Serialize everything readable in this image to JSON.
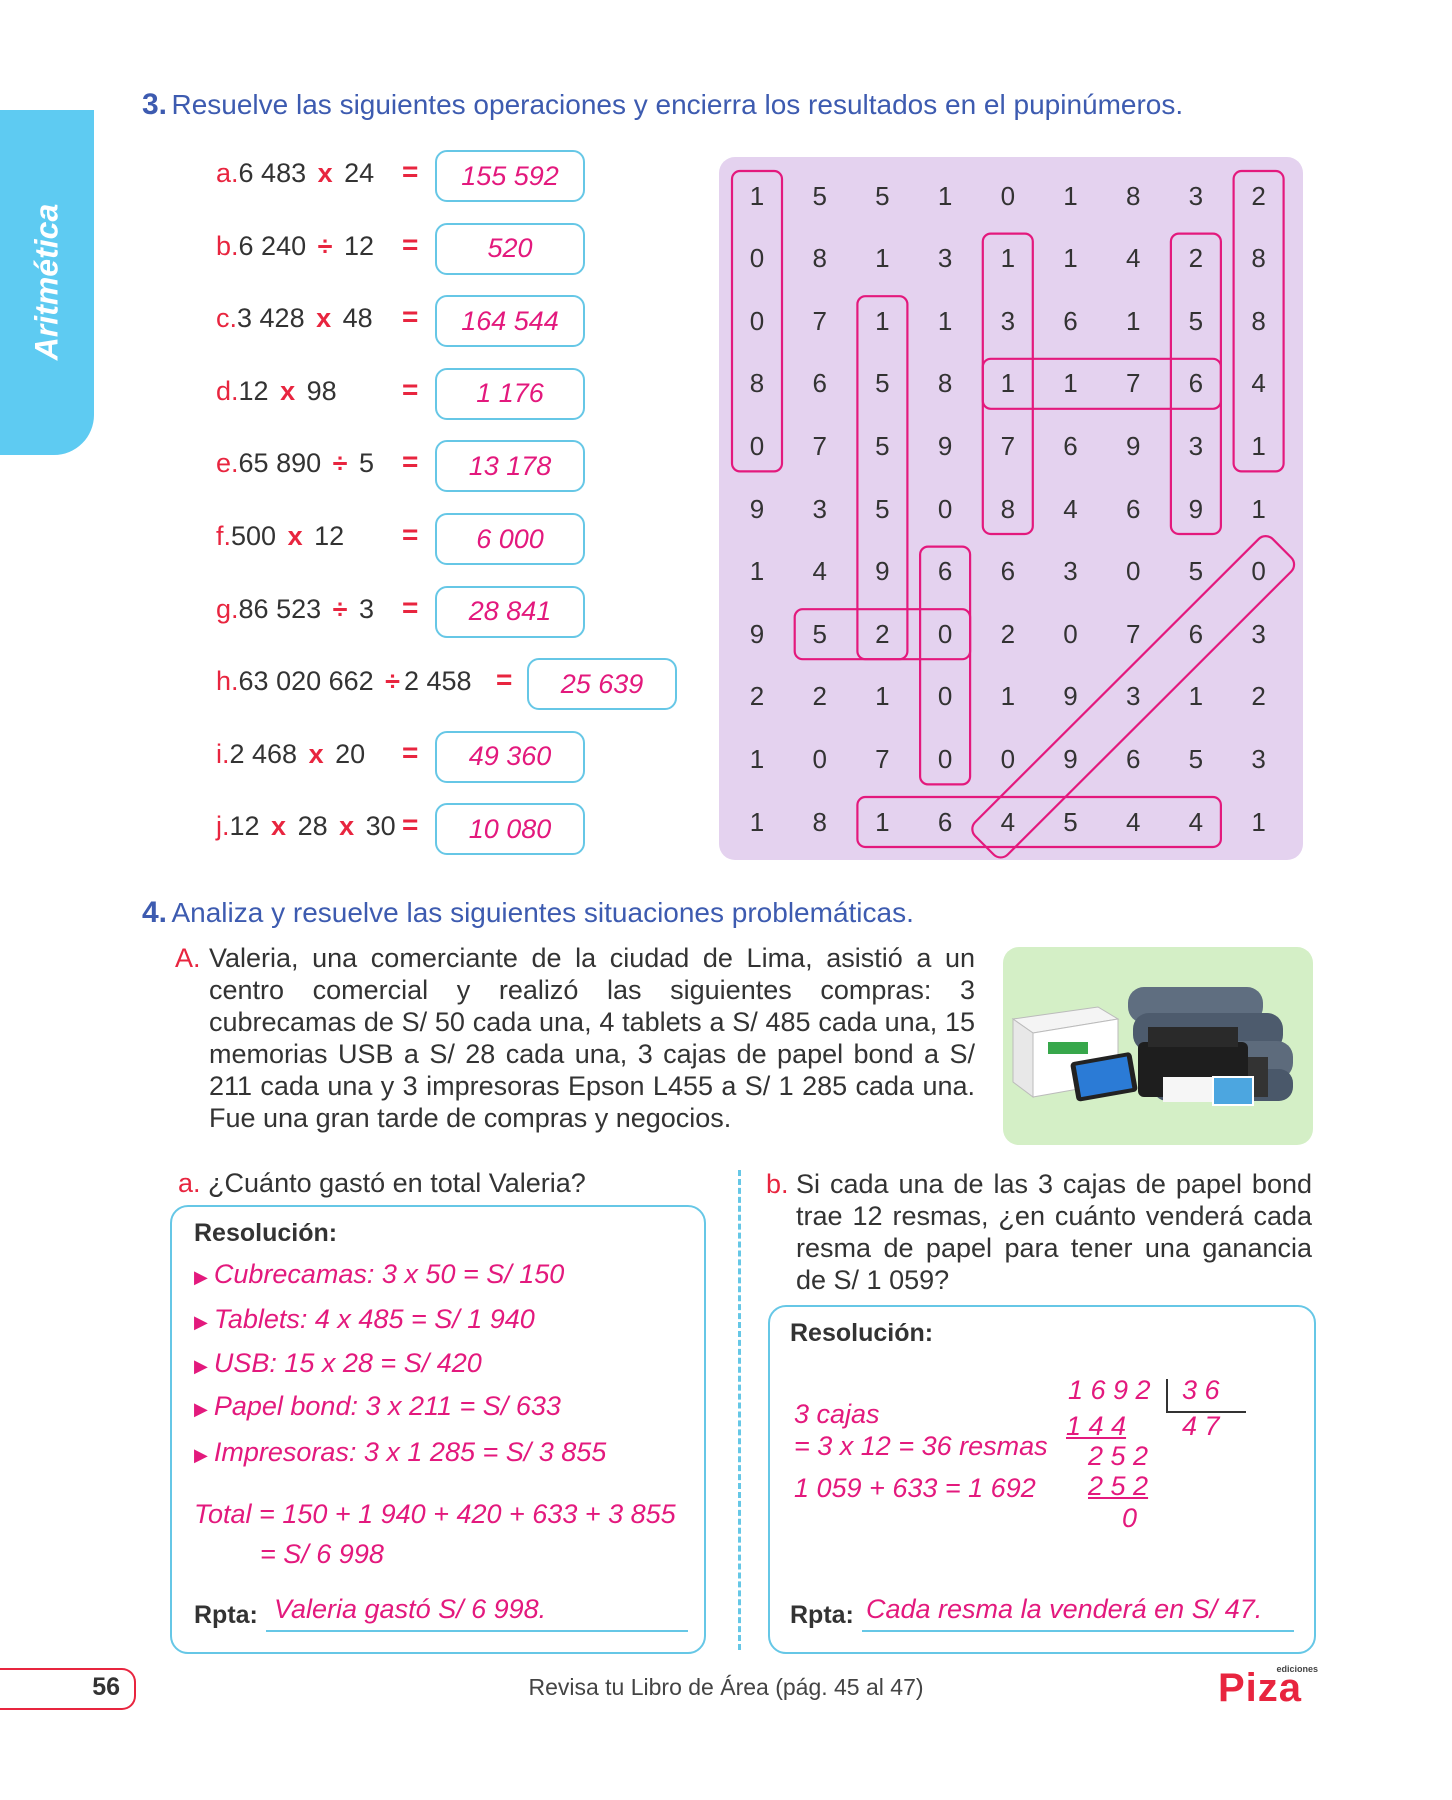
{
  "side_tab": "Aritmética",
  "section3": {
    "number": "3.",
    "title": "Resuelve las siguientes operaciones y encierra los resultados en el pupinúmeros.",
    "operations": [
      {
        "letter": "a.",
        "parts": [
          "6 483 ",
          "x",
          " 24"
        ],
        "answer": "155 592"
      },
      {
        "letter": "b.",
        "parts": [
          "6 240 ",
          "÷",
          " 12"
        ],
        "answer": "520"
      },
      {
        "letter": "c.",
        "parts": [
          "3 428 ",
          "x",
          " 48"
        ],
        "answer": "164 544"
      },
      {
        "letter": "d.",
        "parts": [
          "12 ",
          "x",
          " 98"
        ],
        "answer": "1 176"
      },
      {
        "letter": "e.",
        "parts": [
          "65 890 ",
          "÷",
          " 5"
        ],
        "answer": "13 178"
      },
      {
        "letter": "f.",
        "parts": [
          "500 ",
          "x",
          " 12"
        ],
        "answer": "6 000"
      },
      {
        "letter": "g.",
        "parts": [
          "86 523 ",
          "÷",
          " 3"
        ],
        "answer": "28 841"
      },
      {
        "letter": "h.",
        "parts": [
          "63 020 662 ",
          "÷",
          "2 458"
        ],
        "answer": "25 639"
      },
      {
        "letter": "i.",
        "parts": [
          "2 468 ",
          "x",
          " 20"
        ],
        "answer": "49 360"
      },
      {
        "letter": "j.",
        "parts": [
          "12 ",
          "x",
          " 28 ",
          "x",
          " 30"
        ],
        "answer": "10 080"
      }
    ],
    "equals": "=",
    "grid": [
      [
        "1",
        "5",
        "5",
        "1",
        "0",
        "1",
        "8",
        "3",
        "2"
      ],
      [
        "0",
        "8",
        "1",
        "3",
        "1",
        "1",
        "4",
        "2",
        "8"
      ],
      [
        "0",
        "7",
        "1",
        "1",
        "3",
        "6",
        "1",
        "5",
        "8"
      ],
      [
        "8",
        "6",
        "5",
        "8",
        "1",
        "1",
        "7",
        "6",
        "4"
      ],
      [
        "0",
        "7",
        "5",
        "9",
        "7",
        "6",
        "9",
        "3",
        "1"
      ],
      [
        "9",
        "3",
        "5",
        "0",
        "8",
        "4",
        "6",
        "9",
        "1"
      ],
      [
        "1",
        "4",
        "9",
        "6",
        "6",
        "3",
        "0",
        "5",
        "0"
      ],
      [
        "9",
        "5",
        "2",
        "0",
        "2",
        "0",
        "7",
        "6",
        "3"
      ],
      [
        "2",
        "2",
        "1",
        "0",
        "1",
        "9",
        "3",
        "1",
        "2"
      ],
      [
        "1",
        "0",
        "7",
        "0",
        "0",
        "9",
        "6",
        "5",
        "3"
      ],
      [
        "1",
        "8",
        "1",
        "6",
        "4",
        "5",
        "4",
        "4",
        "1"
      ]
    ]
  },
  "section4": {
    "number": "4.",
    "title": "Analiza y resuelve las siguientes situaciones problemáticas.",
    "problem_letter": "A.",
    "problem_text": "Valeria, una comerciante de la ciudad de Lima, asistió a un centro comercial y realizó las siguientes compras: 3 cubrecamas de S/ 50 cada una, 4 tablets a S/ 485 cada una, 15 memorias USB a S/ 28 cada una, 3 cajas de papel bond a S/ 211 cada una y 3 impresoras Epson L455 a S/ 1 285 cada una. Fue una gran tarde de compras y negocios.",
    "qa": {
      "letter": "a.",
      "question": "¿Cuánto gastó en total Valeria?",
      "resolucion": "Resolución:",
      "lines": [
        "Cubrecamas: 3 x 50 = S/ 150",
        "Tablets: 4 x 485 = S/ 1 940",
        "USB: 15 x 28 = S/ 420",
        "Papel bond: 3 x 211 = S/ 633",
        "Impresoras: 3 x 1 285 = S/ 3 855"
      ],
      "total_1": "Total = 150 + 1 940 + 420 + 633 + 3 855",
      "total_2": "= S/ 6 998",
      "rpta_label": "Rpta:",
      "rpta": "Valeria gastó S/ 6 998."
    },
    "qb": {
      "letter": "b.",
      "question": "Si cada una de las 3 cajas de papel bond trae 12 resmas, ¿en cuánto venderá cada resma de papel para tener una ganancia de  S/ 1 059?",
      "resolucion": "Resolución:",
      "work_1": "3 cajas",
      "work_2": "= 3 x 12 = 36 resmas",
      "work_3": "1 059 + 633 = 1 692",
      "div_dividend": "1 6 9 2",
      "div_divisor": "3 6",
      "div_quotient": "4 7",
      "div_s1": "1 4 4",
      "div_r1": "2 5 2",
      "div_s2": "2 5 2",
      "div_r2": "0",
      "rpta_label": "Rpta:",
      "rpta": "Cada resma la venderá en S/ 47."
    }
  },
  "footer": {
    "page_number": "56",
    "text": "Revisa tu Libro de Área (pág. 45 al 47)",
    "brand": "Piza",
    "brand_small": "ediciones"
  },
  "colors": {
    "accent_blue": "#3d5bb0",
    "tab_cyan": "#5ecbf2",
    "red": "#e8253f",
    "magenta": "#e3197d",
    "box_border": "#66c7e6",
    "grid_bg": "#e4d2ef"
  }
}
